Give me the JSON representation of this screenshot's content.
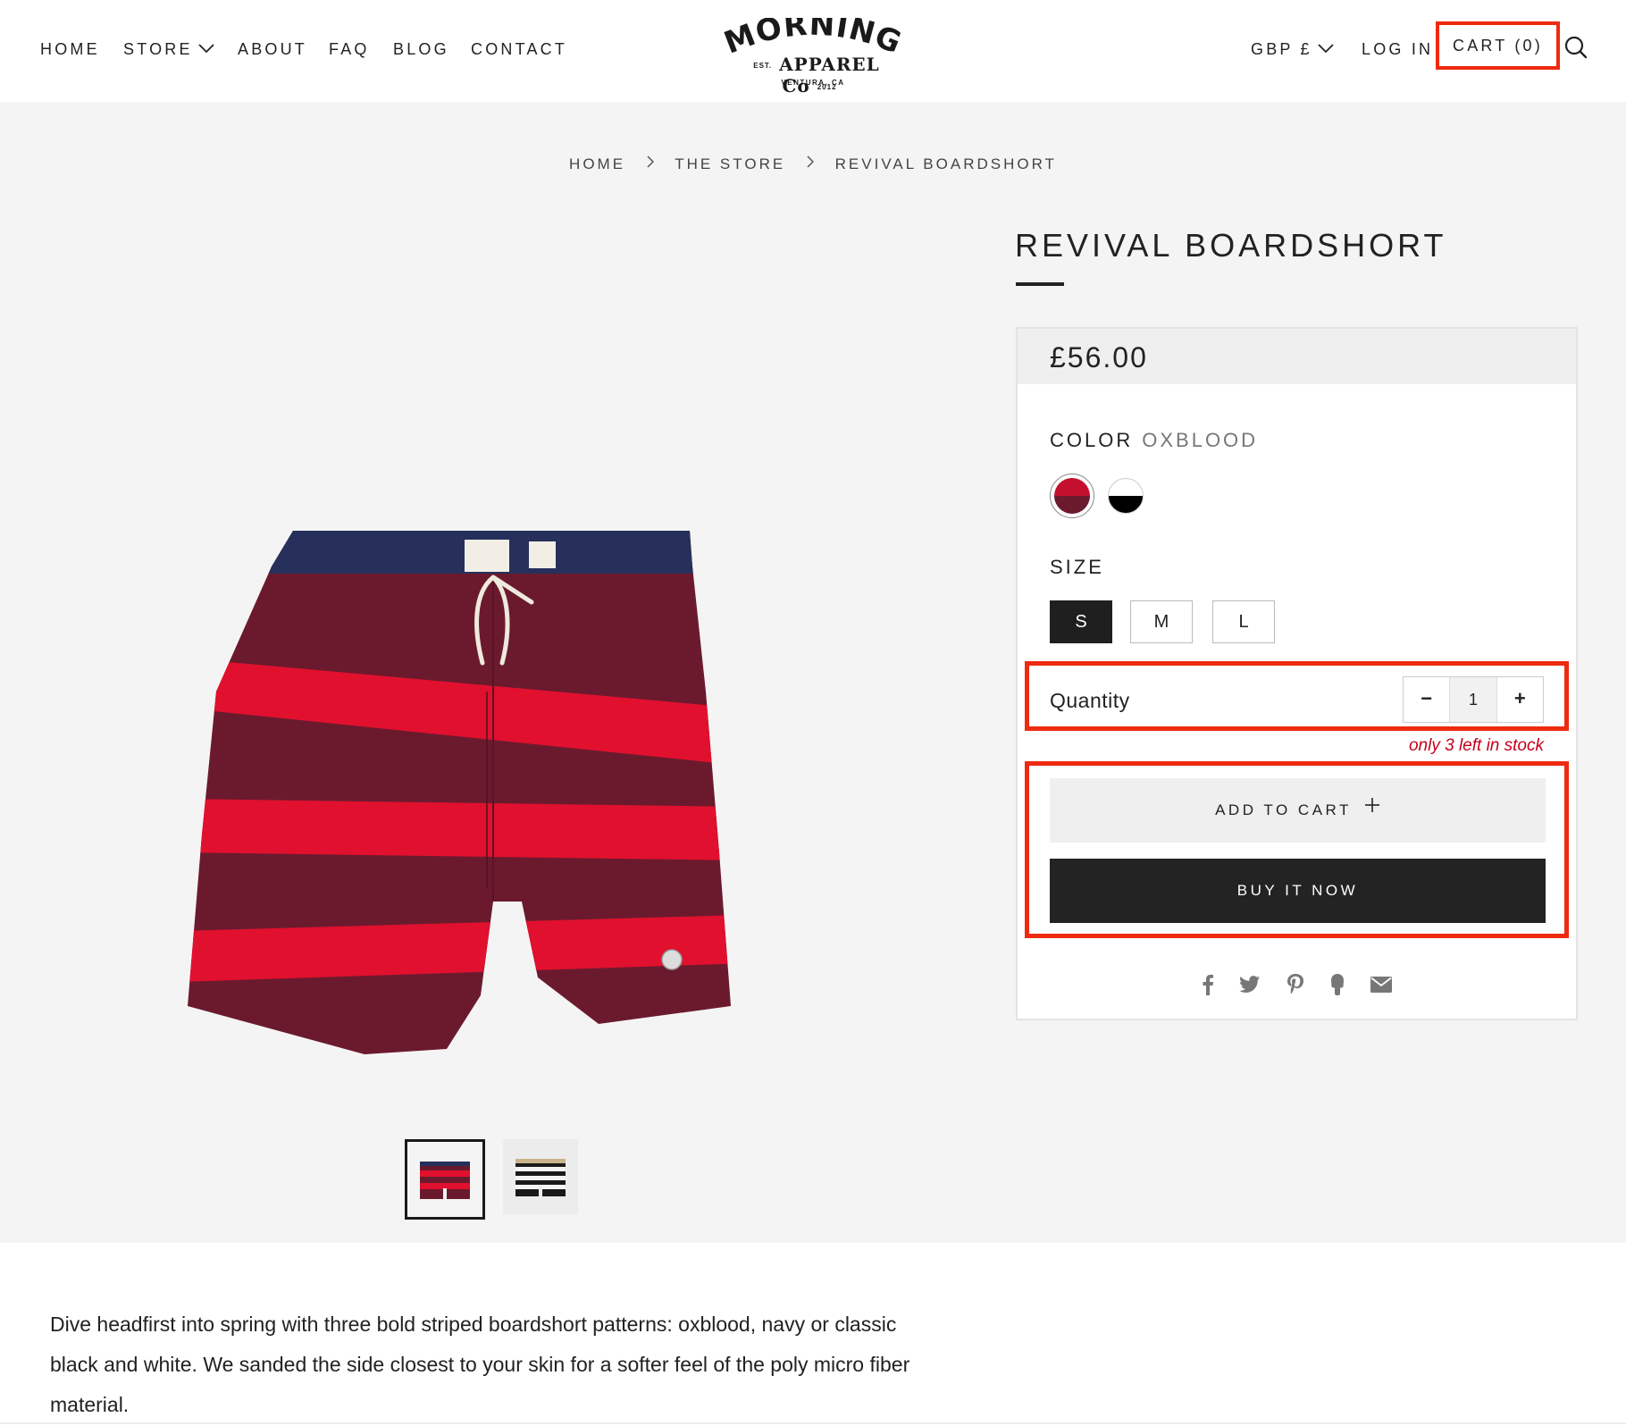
{
  "header": {
    "nav": [
      {
        "label": "HOME"
      },
      {
        "label": "STORE"
      },
      {
        "label": "ABOUT"
      },
      {
        "label": "FAQ"
      },
      {
        "label": "BLOG"
      },
      {
        "label": "CONTACT"
      }
    ],
    "logo": {
      "top": "MORNING",
      "middle": "APPAREL Co",
      "est": "EST.",
      "year": "2012",
      "bottom": "VENTURA, CA"
    },
    "currency": "GBP £",
    "login": "LOG IN",
    "cart": "CART (0)"
  },
  "breadcrumb": [
    "HOME",
    "THE STORE",
    "REVIVAL BOARDSHORT"
  ],
  "product": {
    "title": "REVIVAL BOARDSHORT",
    "price": "£56.00",
    "color_label": "COLOR",
    "color_value": "OXBLOOD",
    "swatches": [
      {
        "name": "oxblood",
        "top": "#c4102e",
        "bottom": "#6b1a2e"
      },
      {
        "name": "black-white",
        "top": "#ffffff",
        "bottom": "#000000"
      }
    ],
    "size_label": "SIZE",
    "sizes": [
      "S",
      "M",
      "L"
    ],
    "selected_size": "S",
    "quantity_label": "Quantity",
    "quantity": "1",
    "qty_minus": "−",
    "qty_plus": "+",
    "stock_note": "only 3 left in stock",
    "add_to_cart": "ADD TO CART",
    "buy_now": "BUY IT NOW",
    "share_icons": [
      "facebook-icon",
      "twitter-icon",
      "pinterest-icon",
      "fancy-icon",
      "email-icon"
    ]
  },
  "description": "Dive headfirst into spring with three bold striped boardshort patterns: oxblood, navy or classic black and white. We sanded the side closest to your skin for a softer feel of the poly micro fiber material.",
  "colors": {
    "highlight": "#ee2a10",
    "stock": "#c4001b",
    "oxblood": "#6b1a2e",
    "stripe_red": "#e0102e",
    "navy": "#26305a"
  }
}
